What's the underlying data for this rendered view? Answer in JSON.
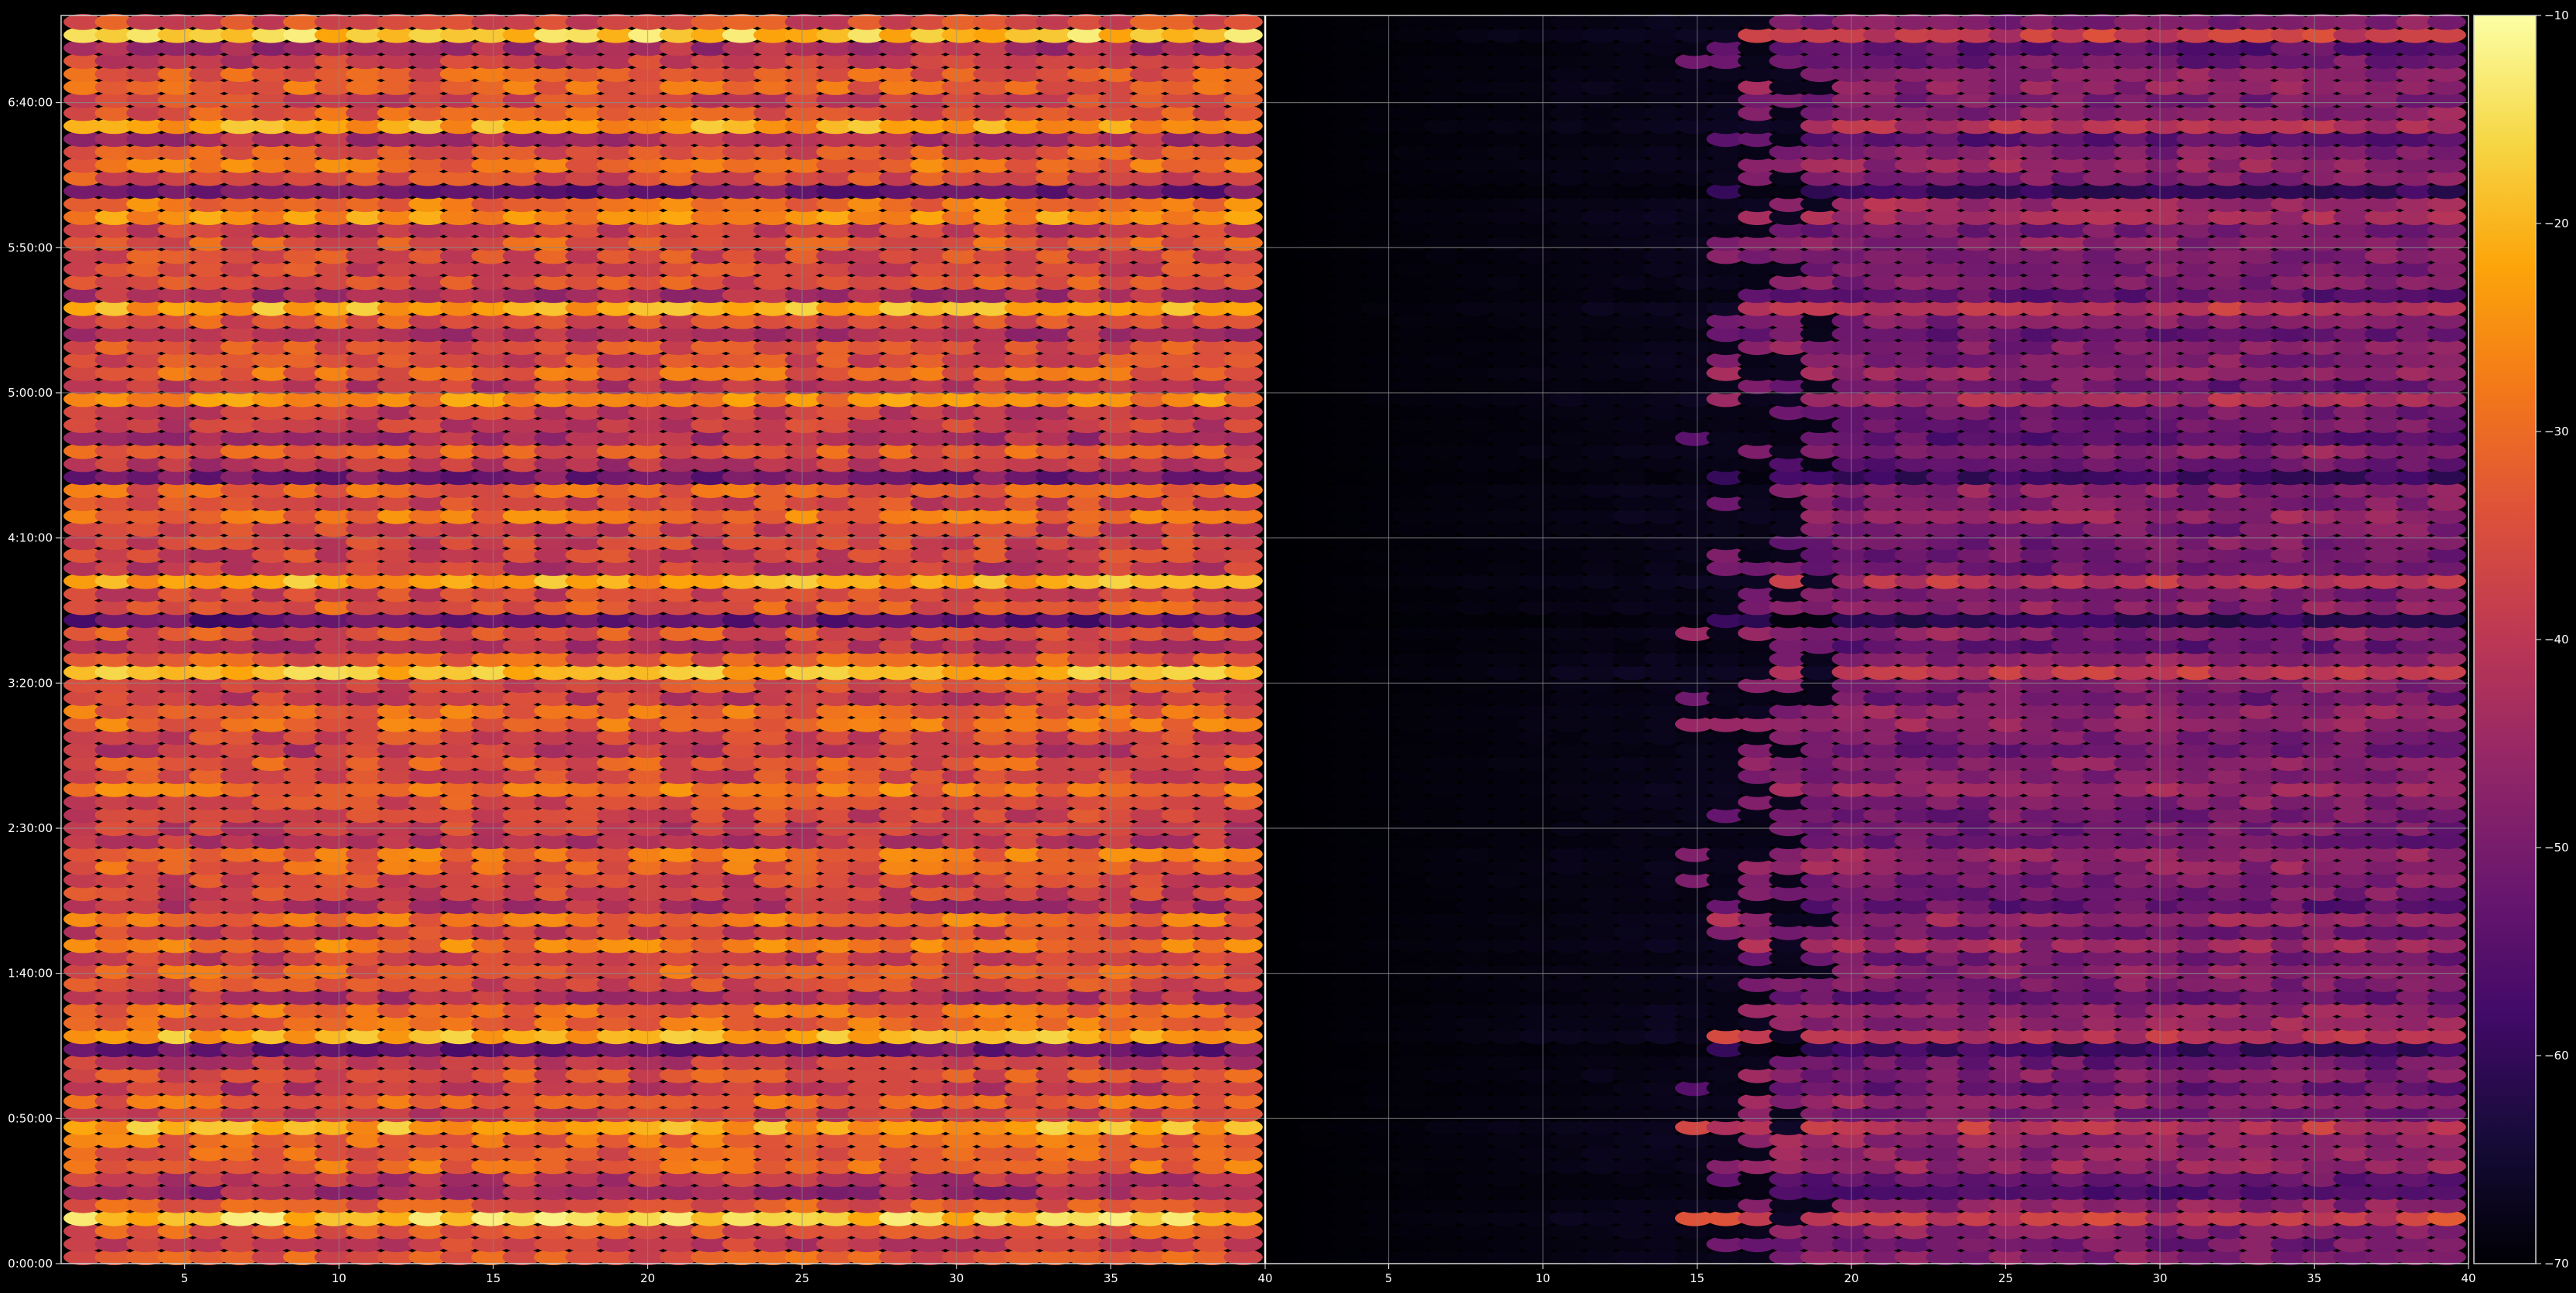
{
  "chart_data": {
    "type": "heatmap",
    "title": "",
    "xlabel": "",
    "ylabel": "",
    "panels": [
      {
        "name": "left",
        "x_range": [
          1,
          40
        ],
        "x_ticks": [
          5,
          10,
          15,
          20,
          25,
          30,
          35,
          40
        ],
        "x_tick_labels": [
          "5",
          "10",
          "15",
          "20",
          "25",
          "30",
          "35",
          "40"
        ],
        "x_label_all": [
          "5",
          "10",
          "15",
          "20",
          "25",
          "30",
          "35",
          "40"
        ]
      },
      {
        "name": "right",
        "x_range": [
          1,
          40
        ],
        "x_ticks": [
          5,
          10,
          15,
          20,
          25,
          30,
          35,
          40
        ],
        "x_tick_labels": [
          "5",
          "10",
          "15",
          "20",
          "25",
          "30",
          "35",
          "40"
        ],
        "x_label_all": [
          "5",
          "10",
          "15",
          "20",
          "25",
          "30",
          "35",
          "40"
        ]
      }
    ],
    "y_range_minutes": [
      0,
      430
    ],
    "y_ticks_minutes": [
      0,
      50,
      100,
      150,
      200,
      250,
      300,
      350,
      400
    ],
    "y_tick_labels": [
      "0:00:00",
      "0:50:00",
      "1:40:00",
      "2:30:00",
      "3:20:00",
      "4:10:00",
      "5:00:00",
      "5:50:00",
      "6:40:00"
    ],
    "colorbar": {
      "range": [
        -70,
        -10
      ],
      "ticks": [
        -70,
        -60,
        -50,
        -40,
        -30,
        -20,
        -10
      ],
      "tick_labels": [
        "−70",
        "−60",
        "−50",
        "−40",
        "−30",
        "−20",
        "−10"
      ],
      "colormap": "inferno"
    },
    "grid": true,
    "background": "#000000",
    "notes_hidden": false
  },
  "colors": {
    "background": "#000000",
    "grid": "#8a8a8a",
    "text": "#ffffff"
  }
}
